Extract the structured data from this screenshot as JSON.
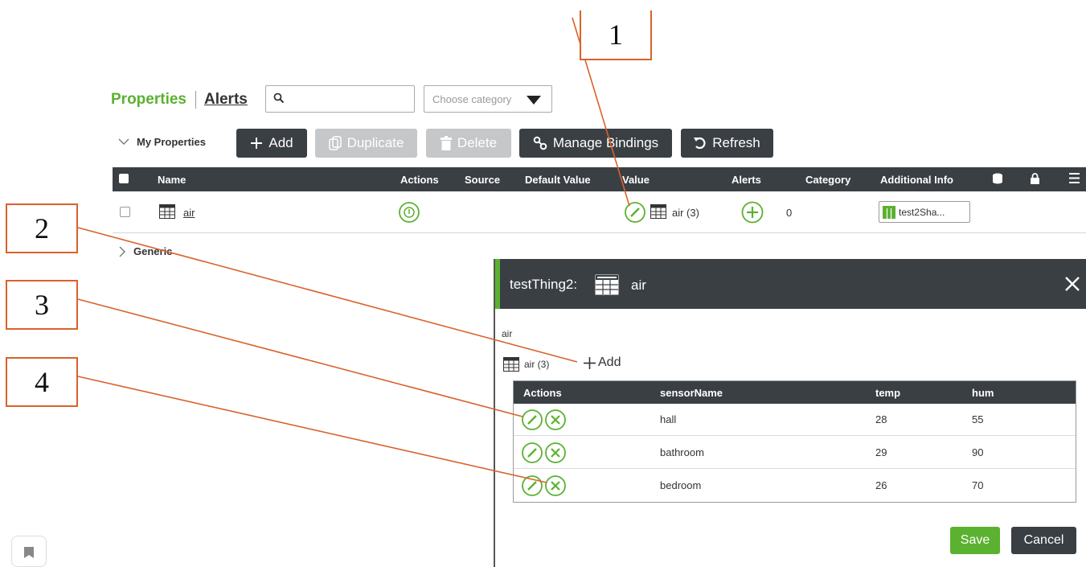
{
  "tabs": {
    "properties": "Properties",
    "alerts": "Alerts"
  },
  "search": {
    "value": "",
    "placeholder": ""
  },
  "category": {
    "placeholder": "Choose category"
  },
  "toolbar": {
    "group_label": "My Properties",
    "add": "Add",
    "duplicate": "Duplicate",
    "delete": "Delete",
    "manage_bindings": "Manage Bindings",
    "refresh": "Refresh"
  },
  "grid": {
    "columns": [
      "Name",
      "Actions",
      "Source",
      "Default Value",
      "Value",
      "Alerts",
      "Category",
      "Additional Info"
    ],
    "row": {
      "name": "air",
      "value": "air (3)",
      "alerts_count": "0",
      "additional_info": "test2Sha..."
    },
    "generic_group": "Generic"
  },
  "dialog": {
    "title": "testThing2:",
    "title_name": "air",
    "field_label": "air",
    "infotable_label": "air (3)",
    "add_label": "Add",
    "columns": [
      "Actions",
      "sensorName",
      "temp",
      "hum"
    ],
    "rows": [
      {
        "sensorName": "hall",
        "temp": "28",
        "hum": "55"
      },
      {
        "sensorName": "bathroom",
        "temp": "29",
        "hum": "90"
      },
      {
        "sensorName": "bedroom",
        "temp": "26",
        "hum": "70"
      }
    ],
    "save": "Save",
    "cancel": "Cancel"
  },
  "callouts": [
    "1",
    "2",
    "3",
    "4"
  ],
  "colors": {
    "accent_green": "#5bb130",
    "dark": "#3a3f44",
    "callout": "#d9622b"
  }
}
